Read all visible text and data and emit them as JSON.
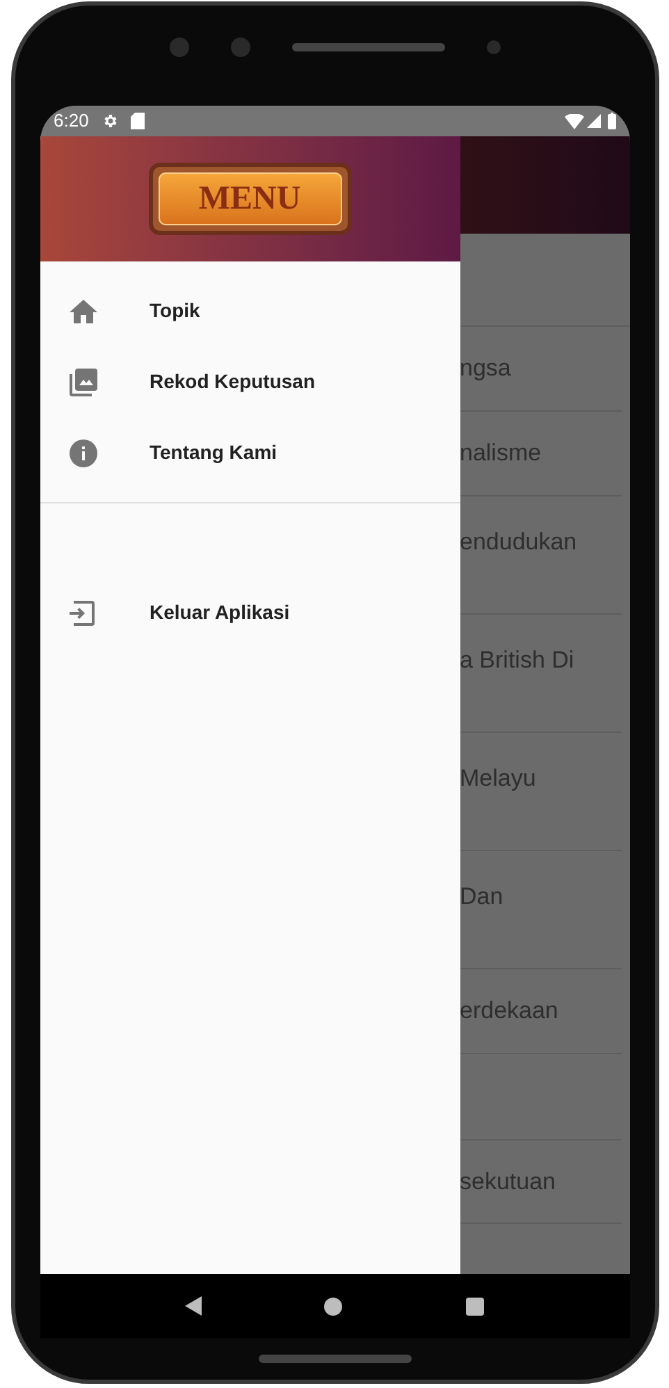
{
  "status_bar": {
    "time": "6:20"
  },
  "drawer": {
    "logo_text": "MENU",
    "items": [
      {
        "kind": "home",
        "label": "Topik"
      },
      {
        "kind": "gallery",
        "label": "Rekod Keputusan"
      },
      {
        "kind": "info",
        "label": "Tentang Kami"
      }
    ],
    "footer_items": [
      {
        "kind": "exit",
        "label": "Keluar Aplikasi"
      }
    ]
  },
  "background_list": [
    {
      "kind": "single",
      "text": "ngsa"
    },
    {
      "kind": "single",
      "text": "nalisme"
    },
    {
      "kind": "double",
      "text": "endudukan"
    },
    {
      "kind": "double",
      "text": "a British Di"
    },
    {
      "kind": "double",
      "text": "Melayu"
    },
    {
      "kind": "double",
      "text": "Dan"
    },
    {
      "kind": "single",
      "text": "erdekaan"
    },
    {
      "kind": "blank_after",
      "text": "sekutuan"
    }
  ]
}
